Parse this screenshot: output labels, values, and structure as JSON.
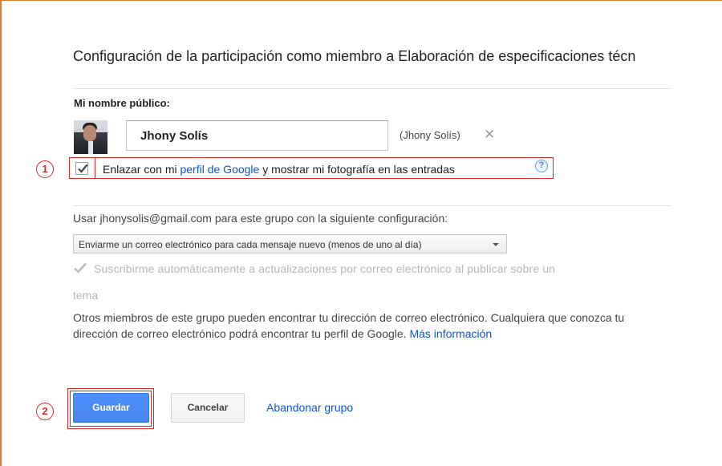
{
  "title": "Configuración de la participación como miembro a Elaboración de especificaciones técn",
  "profile": {
    "label": "Mi nombre público:",
    "name_value": "Jhony Solís",
    "display_name": "(Jhony Solís)",
    "link_checkbox": {
      "checked": true,
      "text_before": "Enlazar con mi ",
      "link_text": "perfil de Google",
      "text_after": " y mostrar mi fotografía en las entradas",
      "help_icon": "?"
    }
  },
  "email_settings": {
    "use_text": "Usar jhonysolis@gmail.com para este grupo con la siguiente configuración:",
    "frequency_selected": "Enviarme un correo electrónico para cada mensaje nuevo (menos de uno al día)",
    "auto_subscribe": {
      "checked": true,
      "disabled": true,
      "line1": "Suscribirme automáticamente a actualizaciones por correo electrónico al publicar sobre un",
      "line2": "tema"
    },
    "info": {
      "text": "Otros miembros de este grupo pueden encontrar tu dirección de correo electrónico. Cualquiera que conozca tu dirección de correo electrónico podrá encontrar tu perfil de Google. ",
      "link": "Más información"
    }
  },
  "actions": {
    "save": "Guardar",
    "cancel": "Cancelar",
    "leave": "Abandonar grupo"
  },
  "annotations": {
    "step1": "1",
    "step2": "2",
    "color": "#d42a2a"
  },
  "colors": {
    "accent_orange": "#e87a2c",
    "link_blue": "#1155cc",
    "save_blue": "#4d90fe"
  },
  "icons": [
    "close-icon",
    "help-icon",
    "checkmark-icon",
    "chevron-down-icon"
  ]
}
